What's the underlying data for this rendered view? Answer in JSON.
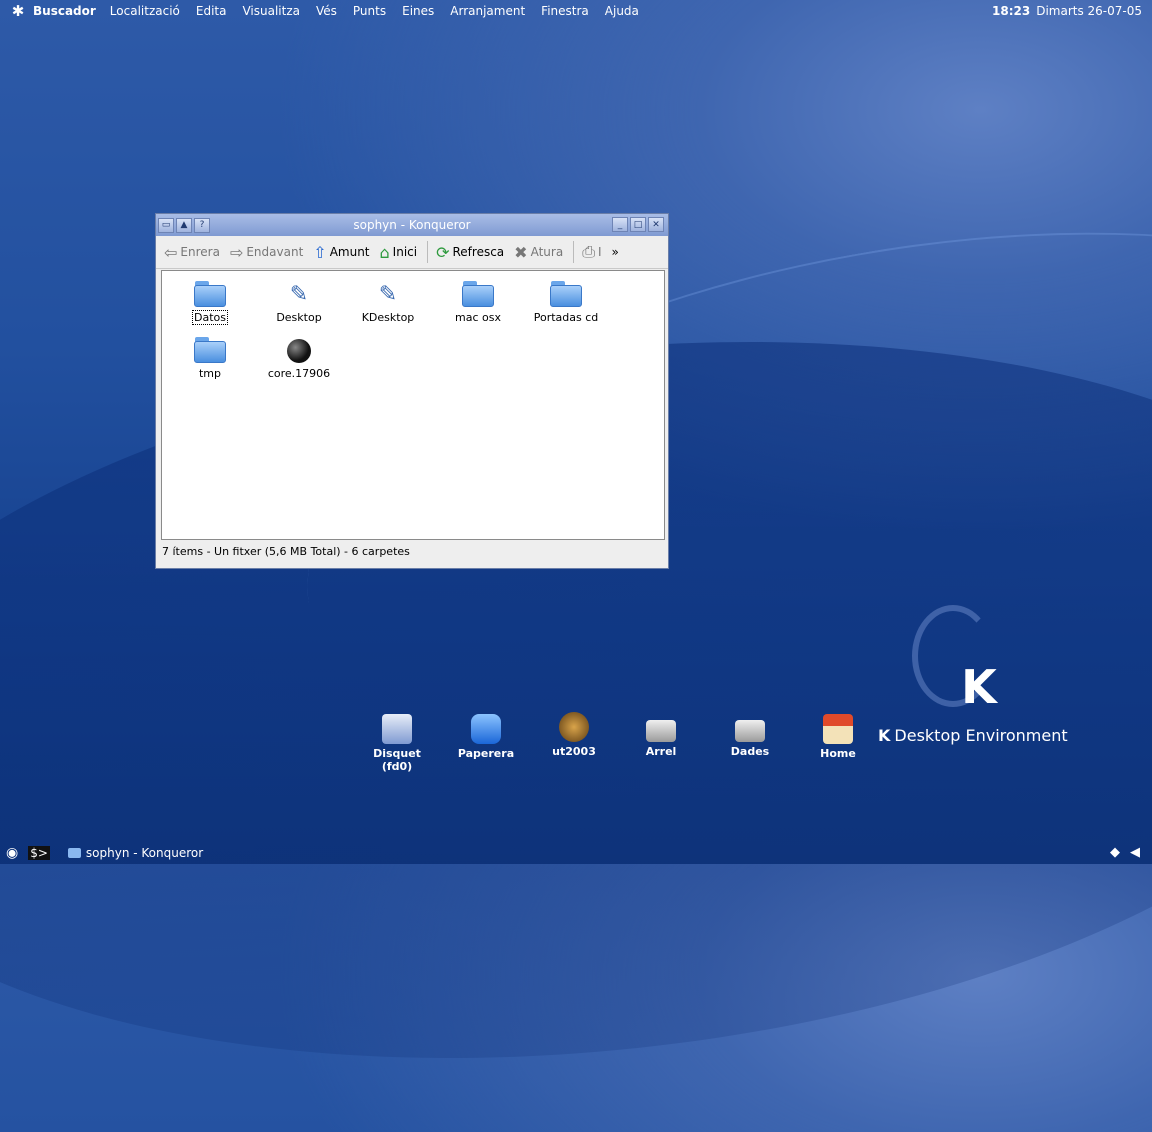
{
  "menubar": {
    "app_name": "Buscador",
    "items": [
      "Localització",
      "Edita",
      "Visualitza",
      "Vés",
      "Punts",
      "Eines",
      "Arranjament",
      "Finestra",
      "Ajuda"
    ],
    "clock_time": "18:23",
    "clock_date": "Dimarts 26-07-05"
  },
  "window": {
    "title": "sophyn - Konqueror",
    "toolbar": {
      "back": "Enrera",
      "forward": "Endavant",
      "up": "Amunt",
      "home": "Inici",
      "reload": "Refresca",
      "stop": "Atura",
      "print_partial": "I"
    },
    "files": [
      {
        "name": "Datos",
        "type": "folder"
      },
      {
        "name": "Desktop",
        "type": "desktop"
      },
      {
        "name": "KDesktop",
        "type": "desktop"
      },
      {
        "name": "mac osx",
        "type": "folder"
      },
      {
        "name": "Portadas cd",
        "type": "folder"
      },
      {
        "name": "tmp",
        "type": "folder"
      },
      {
        "name": "core.17906",
        "type": "core"
      }
    ],
    "status": "7 ítems - Un fitxer (5,6 MB Total) - 6 carpetes"
  },
  "desktop_icons": [
    {
      "line1": "Disquet",
      "line2": "(fd0)",
      "icon": "floppy-icon"
    },
    {
      "line1": "Paperera",
      "line2": "",
      "icon": "trash-icon"
    },
    {
      "line1": "ut2003",
      "line2": "",
      "icon": "ut2003-icon"
    },
    {
      "line1": "Arrel",
      "line2": "",
      "icon": "drive-icon"
    },
    {
      "line1": "Dades",
      "line2": "",
      "icon": "drive-icon"
    },
    {
      "line1": "Home",
      "line2": "",
      "icon": "home-icon"
    }
  ],
  "branding": {
    "k": "K",
    "text": "Desktop Environment"
  },
  "taskbar": {
    "task_title": "sophyn - Konqueror"
  },
  "colors": {
    "accent": "#7f9ad2",
    "desktop": "#1f4f9f"
  }
}
